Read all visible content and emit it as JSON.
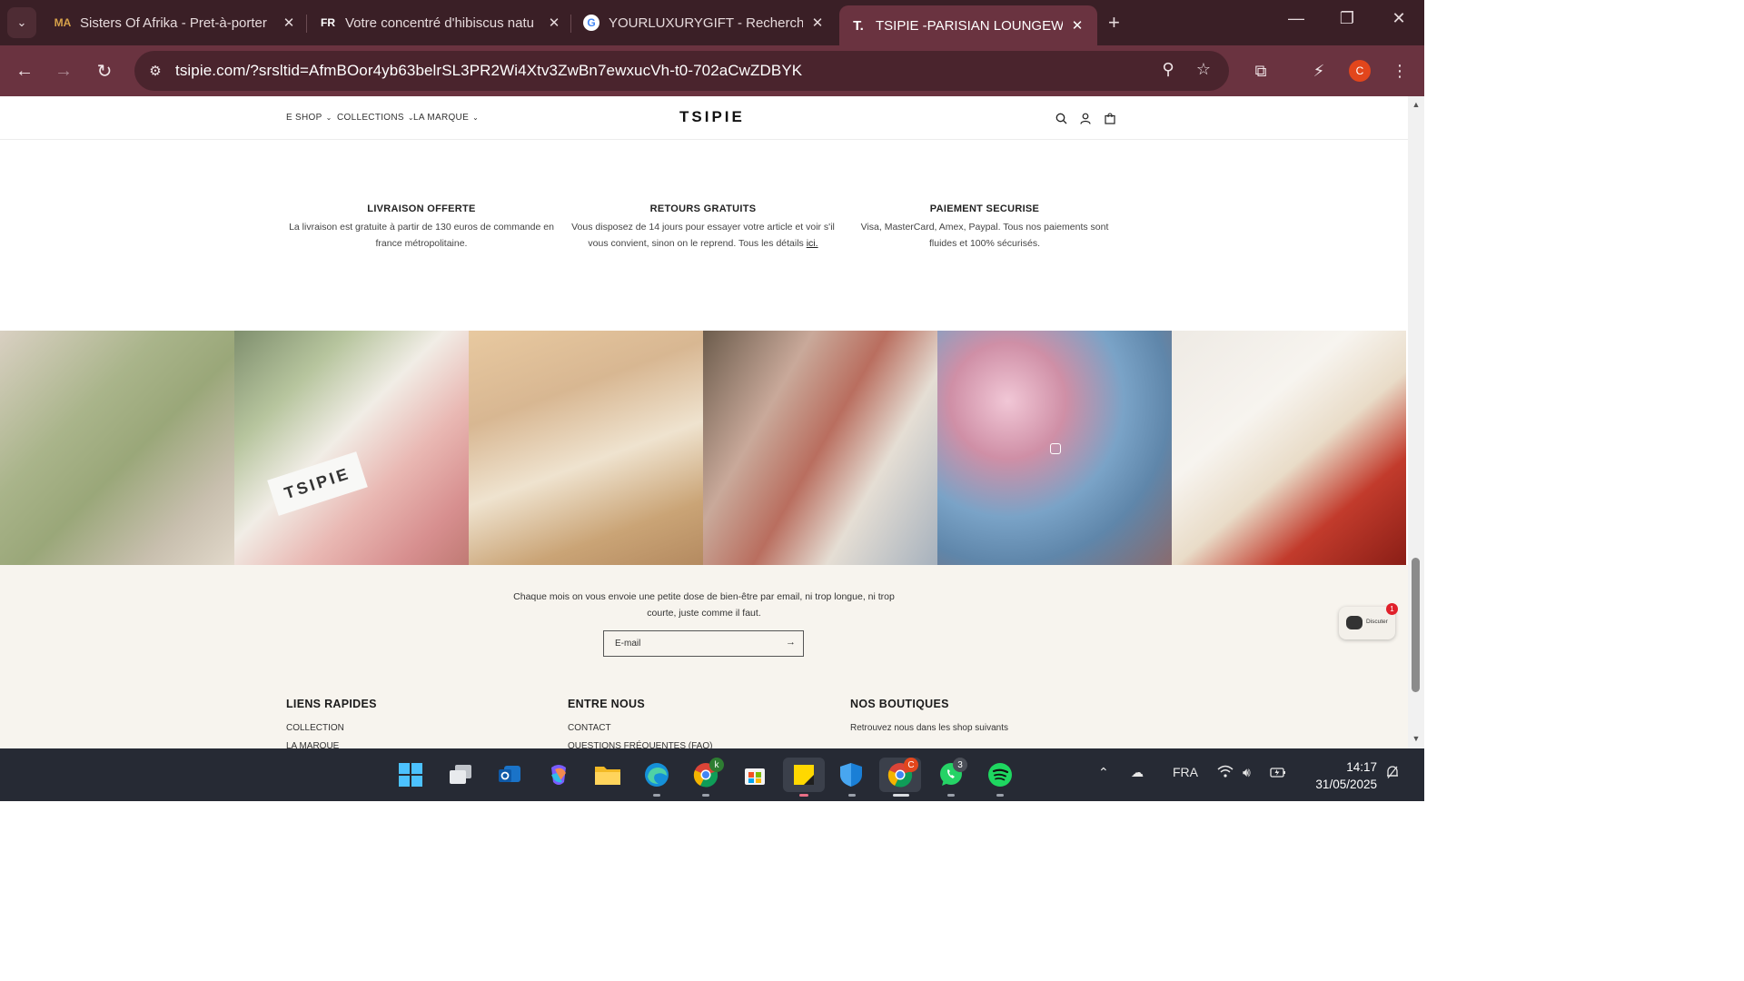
{
  "browser": {
    "tabs": [
      {
        "title": "Sisters Of Afrika - Pret-à-porter",
        "favicon": "MA"
      },
      {
        "title": "Votre concentré d'hibiscus natu",
        "favicon": "FR"
      },
      {
        "title": "YOURLUXURYGIFT - Recherche",
        "favicon": "G"
      },
      {
        "title": "TSIPIE -PARISIAN LOUNGEWEAR",
        "favicon": "T."
      }
    ],
    "url": "tsipie.com/?srsltid=AfmBOor4yb63belrSL3PR2Wi4Xtv3ZwBn7ewxucVh-t0-702aCwZDBYK",
    "profile_initial": "C"
  },
  "site": {
    "menu": {
      "eshop": "E SHOP",
      "collections": "COLLECTIONS",
      "marque": "LA MARQUE"
    },
    "logo": "TSIPIE",
    "features": [
      {
        "title": "LIVRAISON OFFERTE",
        "text": "La livraison est gratuite à partir de 130 euros de commande en france métropolitaine."
      },
      {
        "title": "RETOURS GRATUITS",
        "text": "Vous disposez de 14 jours pour essayer votre article et voir s'il vous convient, sinon on le reprend. Tous les détails",
        "link": "ici."
      },
      {
        "title": "PAIEMENT SECURISE",
        "text": "Visa, MasterCard, Amex, Paypal. Tous nos paiements sont fluides et 100% sécurisés."
      }
    ],
    "gallery_tag": "TSIPIE",
    "newsletter": {
      "text": "Chaque mois on vous envoie une petite dose de bien-être par email, ni trop longue, ni trop courte, juste comme il faut.",
      "placeholder": "E-mail"
    },
    "footer": {
      "col1": {
        "title": "LIENS RAPIDES",
        "items": [
          "COLLECTION",
          "LA MARQUE"
        ]
      },
      "col2": {
        "title": "ENTRE NOUS",
        "items": [
          "CONTACT",
          "QUESTIONS FRÉQUENTES (FAQ)"
        ]
      },
      "col3": {
        "title": "NOS BOUTIQUES",
        "items": [
          "Retrouvez nous dans les shop suivants"
        ]
      }
    },
    "chat": {
      "label": "Discuter",
      "badge": "1"
    }
  },
  "taskbar": {
    "chrome_k_badge": "k",
    "whatsapp_badge": "3",
    "language": "FRA",
    "time": "14:17",
    "date": "31/05/2025"
  }
}
